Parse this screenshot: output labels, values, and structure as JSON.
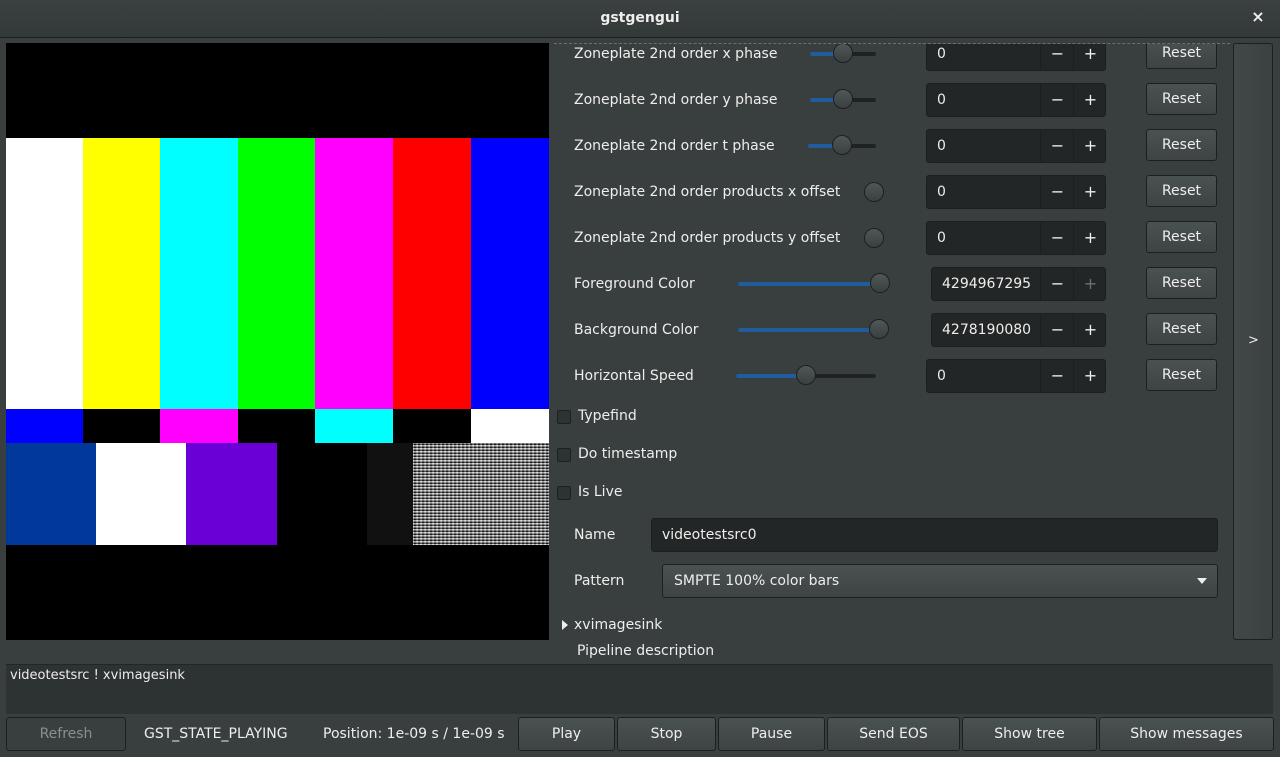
{
  "window": {
    "title": "gstgengui",
    "close": "×"
  },
  "properties": [
    {
      "label": "Zoneplate 2nd order x phase",
      "value": "0",
      "reset": "Reset"
    },
    {
      "label": "Zoneplate 2nd order y phase",
      "value": "0",
      "reset": "Reset"
    },
    {
      "label": "Zoneplate 2nd order t phase",
      "value": "0",
      "reset": "Reset"
    },
    {
      "label": "Zoneplate 2nd order products x offset",
      "value": "0",
      "reset": "Reset"
    },
    {
      "label": "Zoneplate 2nd order products y offset",
      "value": "0",
      "reset": "Reset"
    },
    {
      "label": "Foreground Color",
      "value": "4294967295",
      "reset": "Reset"
    },
    {
      "label": "Background Color",
      "value": "4278190080",
      "reset": "Reset"
    },
    {
      "label": "Horizontal Speed",
      "value": "0",
      "reset": "Reset"
    }
  ],
  "spin": {
    "minus": "−",
    "plus": "+"
  },
  "checkboxes": [
    {
      "label": "Typefind",
      "checked": false
    },
    {
      "label": "Do timestamp",
      "checked": false
    },
    {
      "label": "Is Live",
      "checked": false
    }
  ],
  "name_field": {
    "label": "Name",
    "value": "videotestsrc0"
  },
  "pattern": {
    "label": "Pattern",
    "value": "SMPTE 100% color bars"
  },
  "expander": {
    "label": "xvimagesink"
  },
  "side_toggle": ">",
  "pipeline": {
    "label": "Pipeline description",
    "text": "videotestsrc ! xvimagesink"
  },
  "bottom": {
    "refresh": "Refresh",
    "state": "GST_STATE_PLAYING",
    "position": "Position: 1e-09 s / 1e-09 s",
    "play": "Play",
    "stop": "Stop",
    "pause": "Pause",
    "send_eos": "Send EOS",
    "show_tree": "Show tree",
    "show_messages": "Show messages"
  }
}
